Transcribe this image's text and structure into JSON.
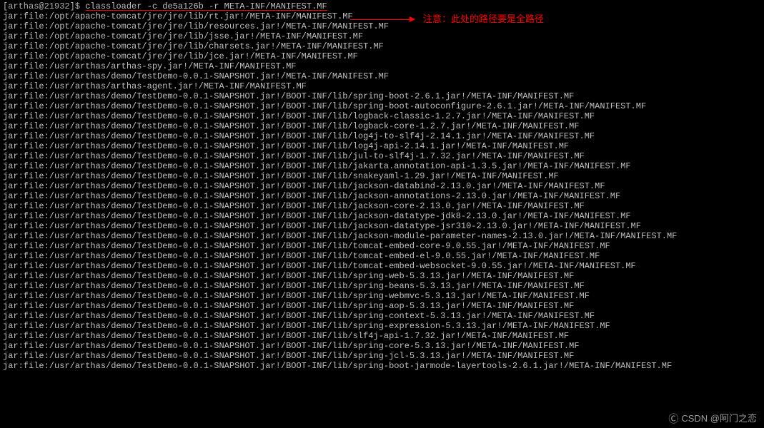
{
  "prompt": "[arthas@21932]$",
  "command": "classloader -c de5a126b  -r META-INF/MANIFEST.MF",
  "annotation": "注意：此处的路径要是全路径",
  "watermark": "CSDN @阿门之恋",
  "output": [
    "jar:file:/opt/apache-tomcat/jre/jre/lib/rt.jar!/META-INF/MANIFEST.MF",
    "jar:file:/opt/apache-tomcat/jre/jre/lib/resources.jar!/META-INF/MANIFEST.MF",
    "jar:file:/opt/apache-tomcat/jre/jre/lib/jsse.jar!/META-INF/MANIFEST.MF",
    "jar:file:/opt/apache-tomcat/jre/jre/lib/charsets.jar!/META-INF/MANIFEST.MF",
    "jar:file:/opt/apache-tomcat/jre/jre/lib/jce.jar!/META-INF/MANIFEST.MF",
    "jar:file:/usr/arthas/arthas-spy.jar!/META-INF/MANIFEST.MF",
    "jar:file:/usr/arthas/demo/TestDemo-0.0.1-SNAPSHOT.jar!/META-INF/MANIFEST.MF",
    "jar:file:/usr/arthas/arthas-agent.jar!/META-INF/MANIFEST.MF",
    "jar:file:/usr/arthas/demo/TestDemo-0.0.1-SNAPSHOT.jar!/BOOT-INF/lib/spring-boot-2.6.1.jar!/META-INF/MANIFEST.MF",
    "jar:file:/usr/arthas/demo/TestDemo-0.0.1-SNAPSHOT.jar!/BOOT-INF/lib/spring-boot-autoconfigure-2.6.1.jar!/META-INF/MANIFEST.MF",
    "jar:file:/usr/arthas/demo/TestDemo-0.0.1-SNAPSHOT.jar!/BOOT-INF/lib/logback-classic-1.2.7.jar!/META-INF/MANIFEST.MF",
    "jar:file:/usr/arthas/demo/TestDemo-0.0.1-SNAPSHOT.jar!/BOOT-INF/lib/logback-core-1.2.7.jar!/META-INF/MANIFEST.MF",
    "jar:file:/usr/arthas/demo/TestDemo-0.0.1-SNAPSHOT.jar!/BOOT-INF/lib/log4j-to-slf4j-2.14.1.jar!/META-INF/MANIFEST.MF",
    "jar:file:/usr/arthas/demo/TestDemo-0.0.1-SNAPSHOT.jar!/BOOT-INF/lib/log4j-api-2.14.1.jar!/META-INF/MANIFEST.MF",
    "jar:file:/usr/arthas/demo/TestDemo-0.0.1-SNAPSHOT.jar!/BOOT-INF/lib/jul-to-slf4j-1.7.32.jar!/META-INF/MANIFEST.MF",
    "jar:file:/usr/arthas/demo/TestDemo-0.0.1-SNAPSHOT.jar!/BOOT-INF/lib/jakarta.annotation-api-1.3.5.jar!/META-INF/MANIFEST.MF",
    "jar:file:/usr/arthas/demo/TestDemo-0.0.1-SNAPSHOT.jar!/BOOT-INF/lib/snakeyaml-1.29.jar!/META-INF/MANIFEST.MF",
    "jar:file:/usr/arthas/demo/TestDemo-0.0.1-SNAPSHOT.jar!/BOOT-INF/lib/jackson-databind-2.13.0.jar!/META-INF/MANIFEST.MF",
    "jar:file:/usr/arthas/demo/TestDemo-0.0.1-SNAPSHOT.jar!/BOOT-INF/lib/jackson-annotations-2.13.0.jar!/META-INF/MANIFEST.MF",
    "jar:file:/usr/arthas/demo/TestDemo-0.0.1-SNAPSHOT.jar!/BOOT-INF/lib/jackson-core-2.13.0.jar!/META-INF/MANIFEST.MF",
    "jar:file:/usr/arthas/demo/TestDemo-0.0.1-SNAPSHOT.jar!/BOOT-INF/lib/jackson-datatype-jdk8-2.13.0.jar!/META-INF/MANIFEST.MF",
    "jar:file:/usr/arthas/demo/TestDemo-0.0.1-SNAPSHOT.jar!/BOOT-INF/lib/jackson-datatype-jsr310-2.13.0.jar!/META-INF/MANIFEST.MF",
    "jar:file:/usr/arthas/demo/TestDemo-0.0.1-SNAPSHOT.jar!/BOOT-INF/lib/jackson-module-parameter-names-2.13.0.jar!/META-INF/MANIFEST.MF",
    "jar:file:/usr/arthas/demo/TestDemo-0.0.1-SNAPSHOT.jar!/BOOT-INF/lib/tomcat-embed-core-9.0.55.jar!/META-INF/MANIFEST.MF",
    "jar:file:/usr/arthas/demo/TestDemo-0.0.1-SNAPSHOT.jar!/BOOT-INF/lib/tomcat-embed-el-9.0.55.jar!/META-INF/MANIFEST.MF",
    "jar:file:/usr/arthas/demo/TestDemo-0.0.1-SNAPSHOT.jar!/BOOT-INF/lib/tomcat-embed-websocket-9.0.55.jar!/META-INF/MANIFEST.MF",
    "jar:file:/usr/arthas/demo/TestDemo-0.0.1-SNAPSHOT.jar!/BOOT-INF/lib/spring-web-5.3.13.jar!/META-INF/MANIFEST.MF",
    "jar:file:/usr/arthas/demo/TestDemo-0.0.1-SNAPSHOT.jar!/BOOT-INF/lib/spring-beans-5.3.13.jar!/META-INF/MANIFEST.MF",
    "jar:file:/usr/arthas/demo/TestDemo-0.0.1-SNAPSHOT.jar!/BOOT-INF/lib/spring-webmvc-5.3.13.jar!/META-INF/MANIFEST.MF",
    "jar:file:/usr/arthas/demo/TestDemo-0.0.1-SNAPSHOT.jar!/BOOT-INF/lib/spring-aop-5.3.13.jar!/META-INF/MANIFEST.MF",
    "jar:file:/usr/arthas/demo/TestDemo-0.0.1-SNAPSHOT.jar!/BOOT-INF/lib/spring-context-5.3.13.jar!/META-INF/MANIFEST.MF",
    "jar:file:/usr/arthas/demo/TestDemo-0.0.1-SNAPSHOT.jar!/BOOT-INF/lib/spring-expression-5.3.13.jar!/META-INF/MANIFEST.MF",
    "jar:file:/usr/arthas/demo/TestDemo-0.0.1-SNAPSHOT.jar!/BOOT-INF/lib/slf4j-api-1.7.32.jar!/META-INF/MANIFEST.MF",
    "jar:file:/usr/arthas/demo/TestDemo-0.0.1-SNAPSHOT.jar!/BOOT-INF/lib/spring-core-5.3.13.jar!/META-INF/MANIFEST.MF",
    "jar:file:/usr/arthas/demo/TestDemo-0.0.1-SNAPSHOT.jar!/BOOT-INF/lib/spring-jcl-5.3.13.jar!/META-INF/MANIFEST.MF",
    "jar:file:/usr/arthas/demo/TestDemo-0.0.1-SNAPSHOT.jar!/BOOT-INF/lib/spring-boot-jarmode-layertools-2.6.1.jar!/META-INF/MANIFEST.MF"
  ]
}
